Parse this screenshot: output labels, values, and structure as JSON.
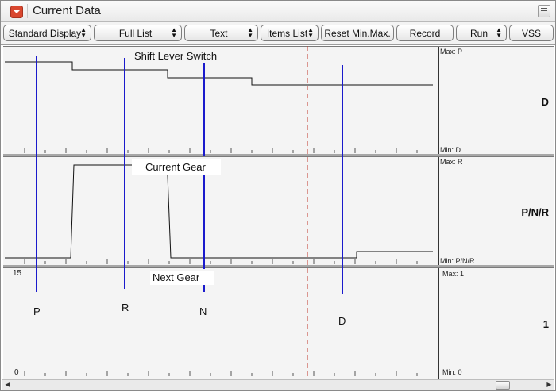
{
  "window": {
    "title": "Current Data"
  },
  "toolbar": {
    "standard_display": "Standard Display",
    "full_list": "Full List",
    "text": "Text",
    "items_list": "Items List",
    "reset_minmax": "Reset Min.Max.",
    "record": "Record",
    "run": "Run",
    "vss": "VSS"
  },
  "graphs": [
    {
      "name": "Shift Lever Switch",
      "max": "Max: P",
      "min": "Min: D",
      "value": "D"
    },
    {
      "name": "Current Gear",
      "max": "Max: R",
      "min": "Min: P/N/R",
      "value": "P/N/R"
    },
    {
      "name": "Next Gear",
      "max": "Max:  1",
      "min": "Min:  0",
      "value": "1",
      "axis_top": "15",
      "axis_bottom": "0"
    }
  ],
  "positions": [
    "P",
    "R",
    "N",
    "D"
  ],
  "colors": {
    "marker": "#1a1acc",
    "cursor": "#c0392b"
  }
}
